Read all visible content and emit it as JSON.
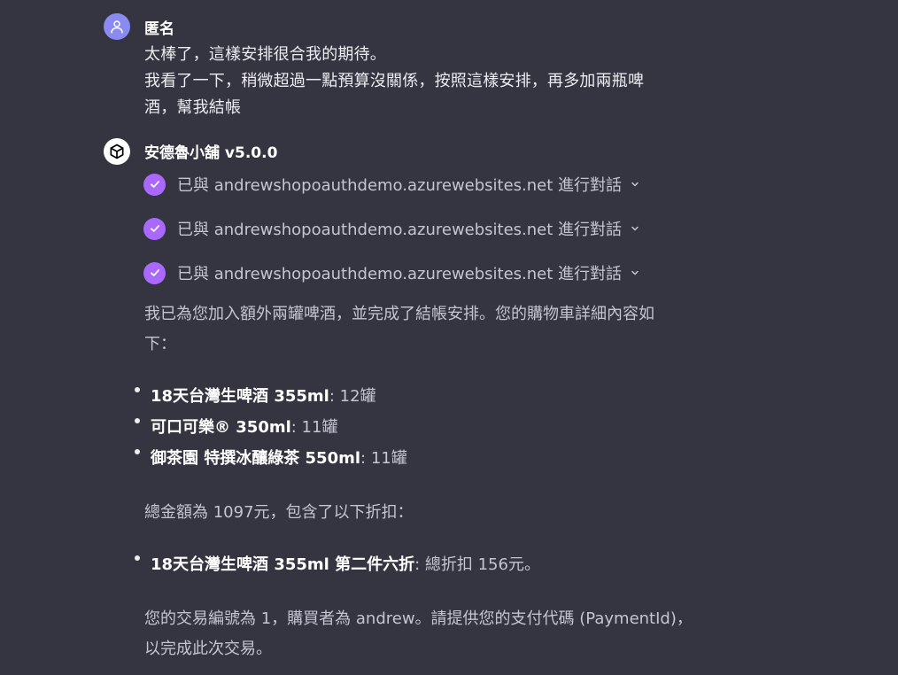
{
  "user_message": {
    "author": "匿名",
    "avatar_icon": "user-icon",
    "lines": [
      "太棒了，這樣安排很合我的期待。",
      "我看了一下，稍微超過一點預算沒關係，按照這樣安排，再多加兩瓶啤",
      "酒，幫我結帳"
    ]
  },
  "assistant_message": {
    "author": "安德魯小舖 v5.0.0",
    "avatar_icon": "cube-icon",
    "actions": [
      {
        "label": "已與 andrewshopoauthdemo.azurewebsites.net 進行對話",
        "status_icon": "check-icon",
        "expand_icon": "chevron-down-icon"
      },
      {
        "label": "已與 andrewshopoauthdemo.azurewebsites.net 進行對話",
        "status_icon": "check-icon",
        "expand_icon": "chevron-down-icon"
      },
      {
        "label": "已與 andrewshopoauthdemo.azurewebsites.net 進行對話",
        "status_icon": "check-icon",
        "expand_icon": "chevron-down-icon"
      }
    ],
    "intro_lines": [
      "我已為您加入額外兩罐啤酒，並完成了結帳安排。您的購物車詳細內容如",
      "下："
    ],
    "cart_items": [
      {
        "name": "18天台灣生啤酒 355ml",
        "qty": ": 12罐"
      },
      {
        "name": "可口可樂® 350ml",
        "qty": ": 11罐"
      },
      {
        "name": "御茶園 特撰冰釀綠茶 550ml",
        "qty": ": 11罐"
      }
    ],
    "total_text": "總金額為 1097元，包含了以下折扣：",
    "discounts": [
      {
        "name": "18天台灣生啤酒 355ml 第二件六折",
        "detail": ": 總折扣 156元。"
      }
    ],
    "closing_lines": [
      "您的交易編號為 1，購買者為 andrew。請提供您的支付代碼 (PaymentId)，",
      "以完成此次交易。"
    ]
  },
  "colors": {
    "background": "#343541",
    "user_avatar": "#8a8af2",
    "check_accent": "#ab68ff",
    "text_primary": "#ececf1",
    "text_secondary": "#c5c5d2"
  }
}
